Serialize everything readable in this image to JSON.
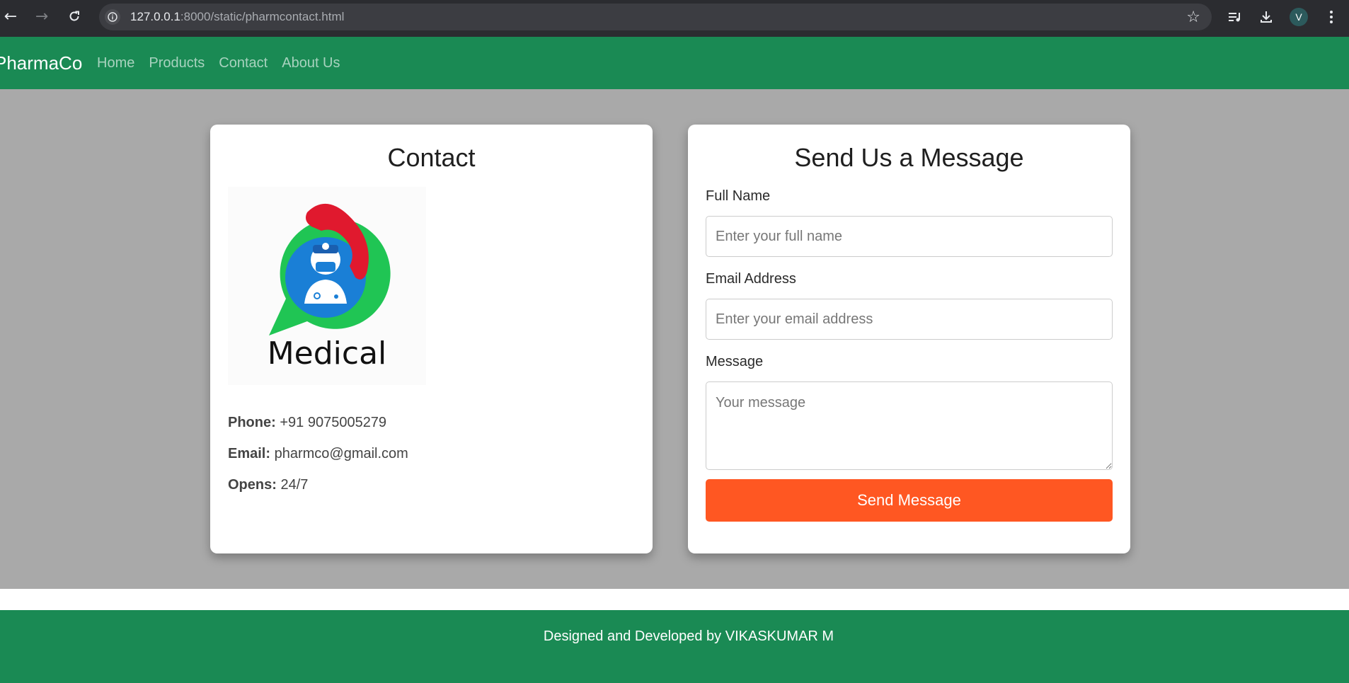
{
  "browser": {
    "url_host": "127.0.0.1",
    "url_rest": ":8000/static/pharmcontact.html",
    "avatar_letter": "V",
    "icons": [
      "back-arrow-icon",
      "forward-arrow-icon",
      "reload-icon",
      "site-info-icon",
      "bookmark-star-icon",
      "media-control-icon",
      "download-icon",
      "more-menu-icon"
    ]
  },
  "navbar": {
    "brand": "PharmaCo",
    "links": [
      "Home",
      "Products",
      "Contact",
      "About Us"
    ]
  },
  "contact_card": {
    "title": "Contact",
    "logo_text": "Medical",
    "phone_label": "Phone:",
    "phone_value": "+91 9075005279",
    "email_label": "Email:",
    "email_value": "pharmco@gmail.com",
    "opens_label": "Opens:",
    "opens_value": "24/7"
  },
  "message_form": {
    "title": "Send Us a Message",
    "name_label": "Full Name",
    "name_placeholder": "Enter your full name",
    "email_label": "Email Address",
    "email_placeholder": "Enter your email address",
    "message_label": "Message",
    "message_placeholder": "Your message",
    "submit_label": "Send Message"
  },
  "footer": {
    "text": "Designed and Developed by VIKASKUMAR M"
  },
  "colors": {
    "brand_green": "#1a8a54",
    "submit_orange": "#ff5722",
    "page_gray": "#a9a9a9"
  }
}
